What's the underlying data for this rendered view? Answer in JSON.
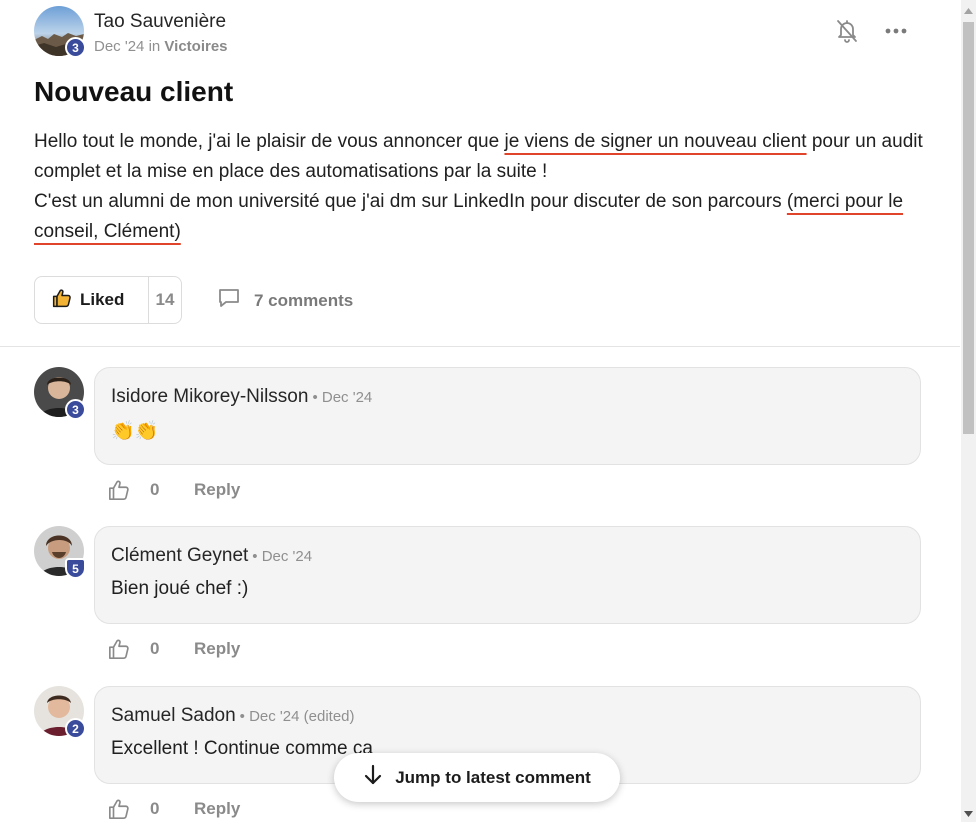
{
  "post": {
    "author": {
      "name": "Tao Sauvenière",
      "level": "3",
      "date": "Dec '24",
      "in_word": "in",
      "category": "Victoires"
    },
    "title": "Nouveau client",
    "body": {
      "part1": "Hello tout le monde, j'ai le plaisir de vous annoncer que ",
      "highlight1": "je viens de signer un nouveau client",
      "part2": " pour un audit complet et la mise en place des automatisations par la suite !",
      "part3": "C'est un alumni de mon université que j'ai dm sur LinkedIn pour discuter de son parcours ",
      "highlight2": "(merci pour le conseil, Clément)"
    },
    "like_label": "Liked",
    "like_count": "14",
    "comments_label": "7 comments"
  },
  "comments": [
    {
      "name": "Isidore Mikorey-Nilsson",
      "date": "• Dec '24",
      "text": "👏👏",
      "level": "3",
      "likes": "0",
      "reply_label": "Reply"
    },
    {
      "name": "Clément Geynet",
      "date": "• Dec '24",
      "text": "Bien joué chef :)",
      "level": "5",
      "likes": "0",
      "reply_label": "Reply"
    },
    {
      "name": "Samuel Sadon",
      "date": "• Dec '24 (edited)",
      "text": "Excellent ! Continue comme ça",
      "level": "2",
      "likes": "0",
      "reply_label": "Reply"
    }
  ],
  "jump_label": "Jump to latest comment",
  "icons": {
    "bell_off": "bell-off-icon",
    "more": "more-horizontal-icon",
    "thumbs_up": "thumbs-up-icon",
    "comment": "comment-bubble-icon",
    "arrow_down": "arrow-down-icon"
  },
  "colors": {
    "highlight_underline": "#e0442a",
    "level_badge": "#3a4b9c",
    "bubble_bg": "#f4f4f4"
  }
}
